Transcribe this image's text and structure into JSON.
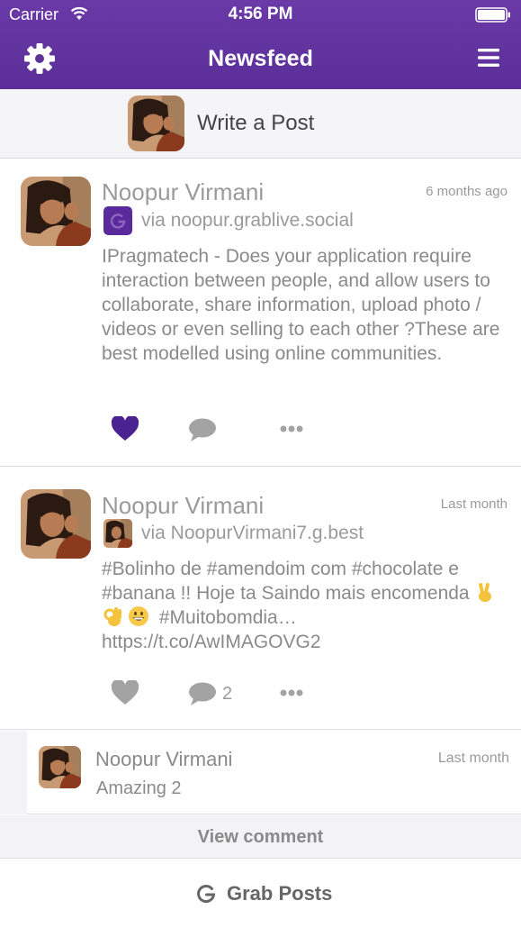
{
  "status_bar": {
    "carrier": "Carrier",
    "time": "4:56 PM"
  },
  "nav": {
    "title": "Newsfeed"
  },
  "composer": {
    "label": "Write a Post"
  },
  "colors": {
    "accent": "#5b2e98",
    "like_active": "#4b2391",
    "muted_text": "#9a9a9a"
  },
  "posts": [
    {
      "author": "Noopur Virmani",
      "timestamp": "6 months ago",
      "source": "via noopur.grablive.social",
      "body": "IPragmatech - Does your application require interaction between people, and allow users to collaborate, share information, upload photo / videos or even selling to each other ?These are best modelled using online communities.",
      "liked": true,
      "comment_count": ""
    },
    {
      "author": "Noopur Virmani",
      "timestamp": "Last month",
      "source": "via NoopurVirmani7.g.best",
      "body_before_emoji": "#Bolinho de #amendoim com #chocolate e #banana !! Hoje ta Saindo mais encomenda ",
      "emoji": [
        "victory-hand",
        "ok-hand",
        "grinning-face"
      ],
      "body_after_emoji": " #Muitobomdia…",
      "link": "https://t.co/AwIMAGOVG2",
      "liked": false,
      "comment_count": "2"
    }
  ],
  "comment": {
    "author": "Noopur Virmani",
    "timestamp": "Last month",
    "text": "Amazing 2"
  },
  "view_comment": {
    "label": "View comment"
  },
  "grab_posts": {
    "label": "Grab Posts"
  }
}
